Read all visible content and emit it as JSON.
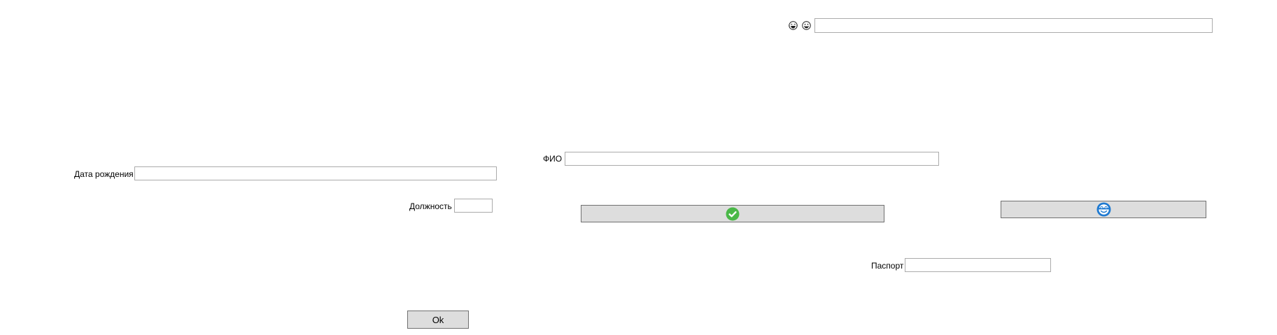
{
  "icons": {
    "face_a": "laughing-face",
    "face_b": "grinning-face",
    "ok_button_icon": "green-check-circle",
    "blue_button_icon": "blue-smiley-circle"
  },
  "colors": {
    "check_green": "#4ab848",
    "blue_icon": "#1f7ad1",
    "button_face": "#dddddd",
    "button_border": "#707070",
    "field_border": "#ababab"
  },
  "form": {
    "top_field": {
      "value": ""
    },
    "fio": {
      "label": "ФИО",
      "value": ""
    },
    "birth_date": {
      "label": "Дата рождения",
      "value": ""
    },
    "position": {
      "label": "Должность",
      "value": ""
    },
    "passport": {
      "label": "Паспорт",
      "value": ""
    },
    "ok_button_label": "Ok"
  }
}
